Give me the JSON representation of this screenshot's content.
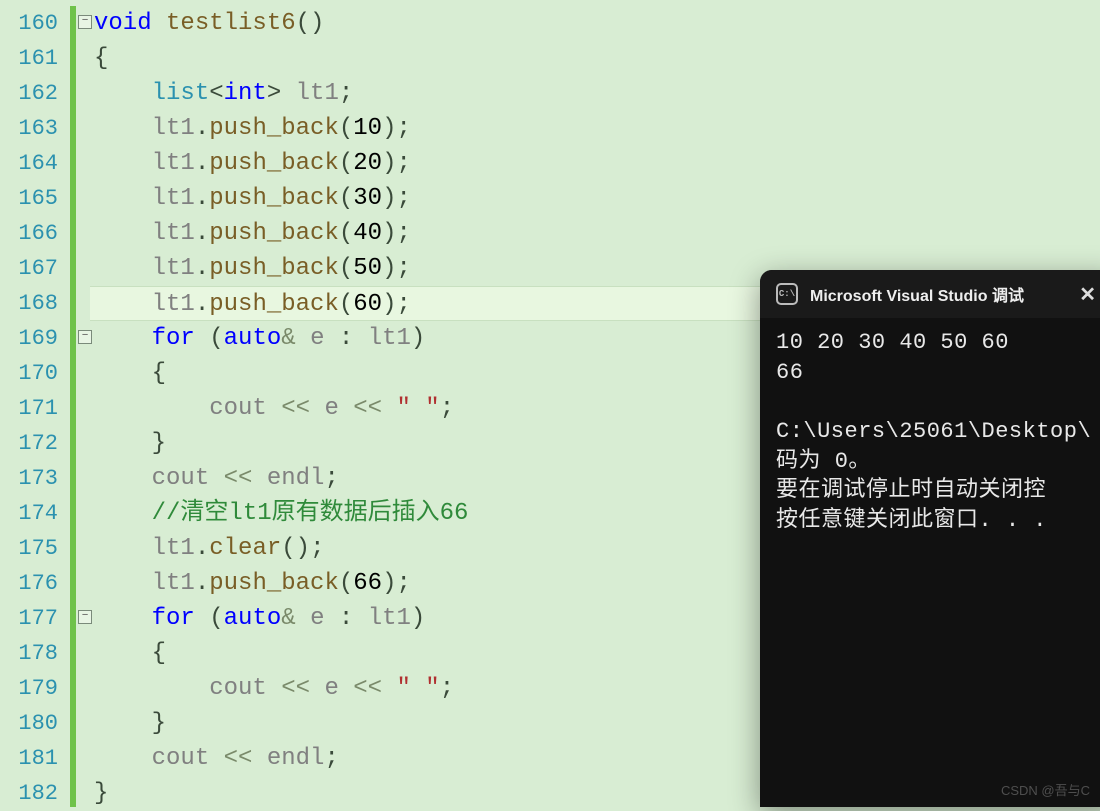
{
  "line_numbers": [
    "160",
    "161",
    "162",
    "163",
    "164",
    "165",
    "166",
    "167",
    "168",
    "169",
    "170",
    "171",
    "172",
    "173",
    "174",
    "175",
    "176",
    "177",
    "178",
    "179",
    "180",
    "181",
    "182"
  ],
  "c": {
    "void": "void",
    "fname": "testlist6",
    "lp": "(",
    "rp": ")",
    "ob": "{",
    "cb": "}",
    "list": "list",
    "lt": "<",
    "int": "int",
    "gt": ">",
    "lt1": "lt1",
    "semi": ";",
    "dot": ".",
    "push_back": "push_back",
    "n10": "10",
    "n20": "20",
    "n30": "30",
    "n40": "40",
    "n50": "50",
    "n60": "60",
    "n66": "66",
    "for": "for",
    "auto": "auto",
    "amp": "&",
    "e": "e",
    "colon": ":",
    "cout": "cout",
    "ll": "<<",
    "space_str": "\" \"",
    "endl": "endl",
    "comment1": "//清空lt1原有数据后插入66",
    "clear": "clear"
  },
  "console": {
    "title": "Microsoft Visual Studio 调试",
    "close": "✕",
    "icon_text": "C:\\",
    "out_line1": "10 20 30 40 50 60 ",
    "out_line2": "66",
    "out_line3": "",
    "out_line4": "C:\\Users\\25061\\Desktop\\",
    "out_line5": "码为 0。",
    "out_line6": "要在调试停止时自动关闭控",
    "out_line7": "按任意键关闭此窗口. . ."
  },
  "watermark": "CSDN @吾与C"
}
